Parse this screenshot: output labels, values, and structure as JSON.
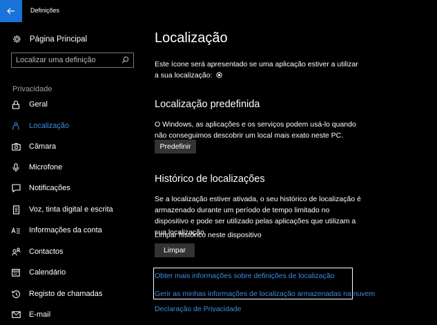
{
  "window": {
    "title": "Definições"
  },
  "sidebar": {
    "home_label": "Página Principal",
    "search_placeholder": "Localizar uma definição",
    "section_label": "Privacidade",
    "items": [
      {
        "label": "Geral",
        "icon": "lock-icon"
      },
      {
        "label": "Localização",
        "icon": "location-person-icon",
        "active": true
      },
      {
        "label": "Câmara",
        "icon": "camera-icon"
      },
      {
        "label": "Microfone",
        "icon": "microphone-icon"
      },
      {
        "label": "Notificações",
        "icon": "notification-icon"
      },
      {
        "label": "Voz, tinta digital e escrita",
        "icon": "notebook-icon"
      },
      {
        "label": "Informações da conta",
        "icon": "account-info-icon"
      },
      {
        "label": "Contactos",
        "icon": "contacts-icon"
      },
      {
        "label": "Calendário",
        "icon": "calendar-icon"
      },
      {
        "label": "Registo de chamadas",
        "icon": "call-history-icon"
      },
      {
        "label": "E-mail",
        "icon": "mail-icon"
      }
    ]
  },
  "main": {
    "title": "Localização",
    "intro_text": "Este ícone será apresentado se uma aplicação estiver a utilizar a sua localização:",
    "default_location": {
      "heading": "Localização predefinida",
      "text": "O Windows, as aplicações e os serviços podem usá-lo quando não conseguimos descobrir um local mais exato neste PC.",
      "button": "Predefinir"
    },
    "history": {
      "heading": "Histórico de localizações",
      "text": "Se a localização estiver ativada, o seu histórico de localização é armazenado durante um período de tempo limitado no dispositivo e pode ser utilizado pelas aplicações que utilizam a sua localização.",
      "clear_label": "Limpar histórico neste dispositivo",
      "clear_button": "Limpar"
    },
    "links": {
      "more_info": "Obter mais informações sobre definições de localização",
      "manage_cloud": "Gerir as minhas informações de localização armazenadas na nuvem",
      "privacy": "Declaração de Privacidade"
    }
  },
  "colors": {
    "accent": "#3b8fe0",
    "back_button": "#1a73d9",
    "button_bg": "#333333"
  }
}
